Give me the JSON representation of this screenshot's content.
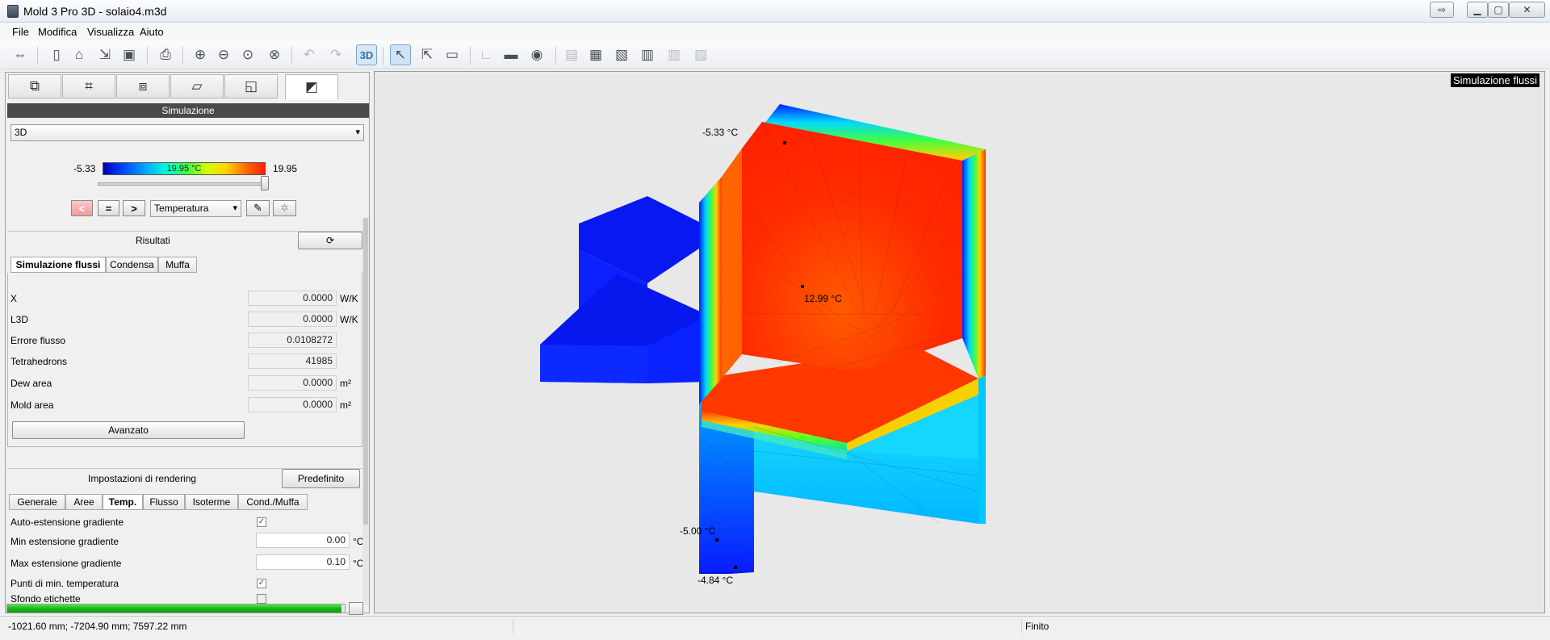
{
  "window": {
    "title": "Mold 3 Pro 3D - solaio4.m3d",
    "controls": [
      "minimize",
      "maximize",
      "close"
    ]
  },
  "menu": [
    "File",
    "Modifica",
    "Visualizza",
    "Aiuto"
  ],
  "toolbar": {
    "items": [
      "pan-icon",
      "new-file-icon",
      "open-file-icon",
      "import-icon",
      "save-icon",
      "print-icon",
      "zoom-in-icon",
      "zoom-out-icon",
      "zoom-fit-icon",
      "zoom-window-icon",
      "undo-icon",
      "redo-icon",
      "view-3d-icon",
      "select-icon",
      "select-add-icon",
      "measure-icon",
      "dimension-icon",
      "comment-icon",
      "visibility-icon",
      "report-icon",
      "report-table-icon",
      "report-export-icon",
      "chart-icon",
      "chart-disabled-icon",
      "report-disabled-icon"
    ],
    "view_3d_label": "3D"
  },
  "side_tabs": [
    "geometry-icon",
    "dimensions-icon",
    "materials-icon",
    "layers-icon",
    "boundary-icon",
    "simulation-icon"
  ],
  "simulation": {
    "header": "Simulazione",
    "view_mode": "3D",
    "scale_min": "-5.33",
    "scale_max": "19.95",
    "scale_current": "19.95 °C",
    "slider_fraction": 1.0,
    "buttons": {
      "prev": "<",
      "equal": "=",
      "next": ">"
    },
    "quantity": "Temperatura"
  },
  "results": {
    "header": "Risultati",
    "tabs": [
      "Simulazione flussi",
      "Condensa",
      "Muffa"
    ],
    "rows": [
      {
        "label": "X",
        "value": "0.0000",
        "unit": "W/K"
      },
      {
        "label": "L3D",
        "value": "0.0000",
        "unit": "W/K"
      },
      {
        "label": "Errore flusso",
        "value": "0.0108272",
        "unit": ""
      },
      {
        "label": "Tetrahedrons",
        "value": "41985",
        "unit": ""
      },
      {
        "label": "Dew area",
        "value": "0.0000",
        "unit": "m²"
      },
      {
        "label": "Mold area",
        "value": "0.0000",
        "unit": "m²"
      }
    ],
    "advanced_button": "Avanzato"
  },
  "rendering": {
    "header": "Impostazioni di rendering",
    "default_button": "Predefinito",
    "tabs": [
      "Generale",
      "Aree",
      "Temp.",
      "Flusso",
      "Isoterme",
      "Cond./Muffa"
    ],
    "rows": [
      {
        "label": "Auto-estensione gradiente",
        "type": "check",
        "checked": true
      },
      {
        "label": "Min estensione gradiente",
        "type": "value",
        "value": "0.00",
        "unit": "°C"
      },
      {
        "label": "Max estensione gradiente",
        "type": "value",
        "value": "0.10",
        "unit": "°C"
      },
      {
        "label": "Punti di min. temperatura",
        "type": "check",
        "checked": true
      },
      {
        "label": "Sfondo etichette",
        "type": "check",
        "checked": false
      }
    ]
  },
  "progress": {
    "fraction": 0.99
  },
  "viewport": {
    "label": "Simulazione flussi",
    "temp_labels": [
      "-5.33 °C",
      "12.99 °C",
      "-5.00 °C",
      "-4.84 °C"
    ]
  },
  "status": {
    "coordinates": "-1021.60 mm; -7204.90 mm; 7597.22 mm",
    "middle": "",
    "state": "Finito"
  }
}
